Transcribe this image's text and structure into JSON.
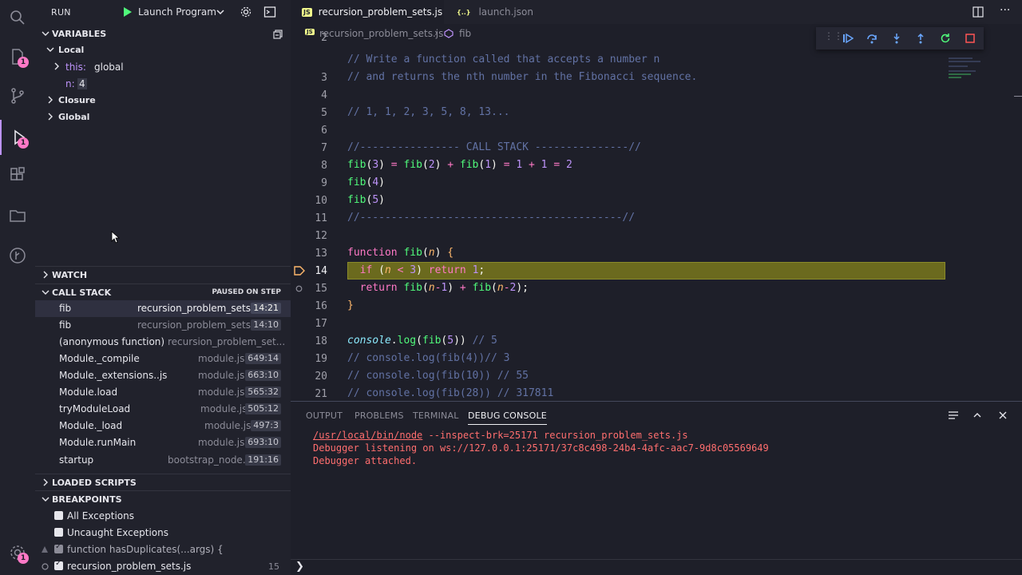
{
  "run_bar": {
    "title": "RUN",
    "config": "Launch Program"
  },
  "activity_badges": {
    "explorer": "1",
    "debug": "1",
    "settings": "1"
  },
  "variables": {
    "header": "VARIABLES",
    "local": "Local",
    "this_key": "this:",
    "this_val": "global",
    "n_key": "n:",
    "n_val": "4",
    "closure": "Closure",
    "global": "Global"
  },
  "watch": {
    "header": "WATCH"
  },
  "call_stack": {
    "header": "CALL STACK",
    "status": "PAUSED ON STEP",
    "frames": [
      {
        "fn": "fib",
        "file": "recursion_problem_sets.js",
        "line": "14:21"
      },
      {
        "fn": "fib",
        "file": "recursion_problem_sets.js",
        "line": "14:10"
      },
      {
        "fn": "(anonymous function)",
        "file": "recursion_problem_set...",
        "line": ""
      },
      {
        "fn": "Module._compile",
        "file": "module.js",
        "line": "649:14"
      },
      {
        "fn": "Module._extensions..js",
        "file": "module.js",
        "line": "663:10"
      },
      {
        "fn": "Module.load",
        "file": "module.js",
        "line": "565:32"
      },
      {
        "fn": "tryModuleLoad",
        "file": "module.js",
        "line": "505:12"
      },
      {
        "fn": "Module._load",
        "file": "module.js",
        "line": "497:3"
      },
      {
        "fn": "Module.runMain",
        "file": "module.js",
        "line": "693:10"
      },
      {
        "fn": "startup",
        "file": "bootstrap_node.js",
        "line": "191:16"
      }
    ]
  },
  "loaded_scripts": {
    "header": "LOADED SCRIPTS"
  },
  "breakpoints": {
    "header": "BREAKPOINTS",
    "items": [
      {
        "label": "All Exceptions",
        "count": ""
      },
      {
        "label": "Uncaught Exceptions",
        "count": ""
      },
      {
        "label": "function hasDuplicates(...args) {",
        "count": ""
      },
      {
        "label": "recursion_problem_sets.js",
        "count": "15"
      }
    ]
  },
  "tabs": [
    {
      "label": "recursion_problem_sets.js",
      "icon": "JS"
    },
    {
      "label": "launch.json",
      "icon": "{..}"
    }
  ],
  "breadcrumb": {
    "file": "recursion_problem_sets.js",
    "symbol": "fib"
  },
  "code": {
    "line_numbers": [
      "2",
      "3",
      "4",
      "5",
      "6",
      "7",
      "8",
      "9",
      "10",
      "11",
      "12",
      "13",
      "14",
      "15",
      "16",
      "17",
      "18",
      "19",
      "20",
      "21"
    ],
    "l2": "// Write a function called that accepts a number n",
    "l3": "// and returns the nth number in the Fibonacci sequence.",
    "l5": "// 1, 1, 2, 3, 5, 8, 13...",
    "l7": "//---------------- CALL STACK ---------------//",
    "l11": "//------------------------------------------//",
    "l19": "// console.log(fib(4))// 3",
    "l20": "// console.log(fib(10)) // 55",
    "l21": "// console.log(fib(28)) // 317811"
  },
  "panel": {
    "tabs": [
      "OUTPUT",
      "PROBLEMS",
      "TERMINAL",
      "DEBUG CONSOLE"
    ],
    "console": {
      "path": "/usr/local/bin/node",
      "args": " --inspect-brk=25171 recursion_problem_sets.js",
      "l2": "Debugger listening on ws://127.0.0.1:25171/37c8c498-24b4-4afc-aac7-9d8c05569649",
      "l3": "Debugger attached."
    },
    "prompt": "❯"
  }
}
